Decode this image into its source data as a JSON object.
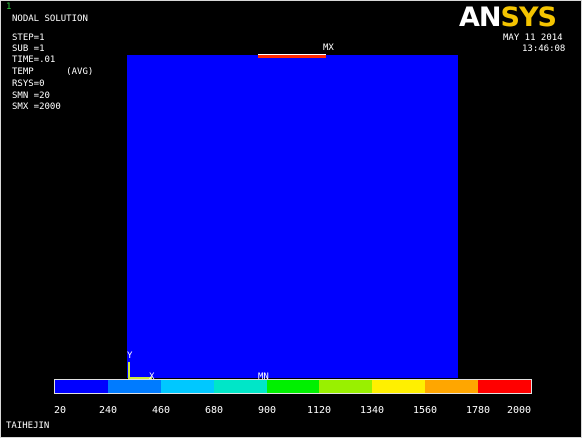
{
  "window": {
    "number": "1"
  },
  "logo": {
    "an": "AN",
    "sys": "SYS"
  },
  "date": "MAY 11 2014",
  "time": "13:46:08",
  "info": {
    "title": "NODAL SOLUTION",
    "step": "STEP=1",
    "sub": "SUB =1",
    "time": "TIME=.01",
    "temp": "TEMP      (AVG)",
    "rsys": "RSYS=0",
    "smn": "SMN =20",
    "smx": "SMX =2000"
  },
  "markers": {
    "mx": "MX",
    "mn": "MN",
    "y": "Y",
    "x": "X"
  },
  "legend": {
    "colors": [
      "#0000ff",
      "#007bff",
      "#00c8ff",
      "#00e6c8",
      "#00f000",
      "#99f000",
      "#fff000",
      "#ffa600",
      "#ff0000"
    ],
    "labels": [
      "20",
      "240",
      "460",
      "680",
      "900",
      "1120",
      "1340",
      "1560",
      "1780",
      "2000"
    ]
  },
  "jobname": "TAIHEJIN"
}
